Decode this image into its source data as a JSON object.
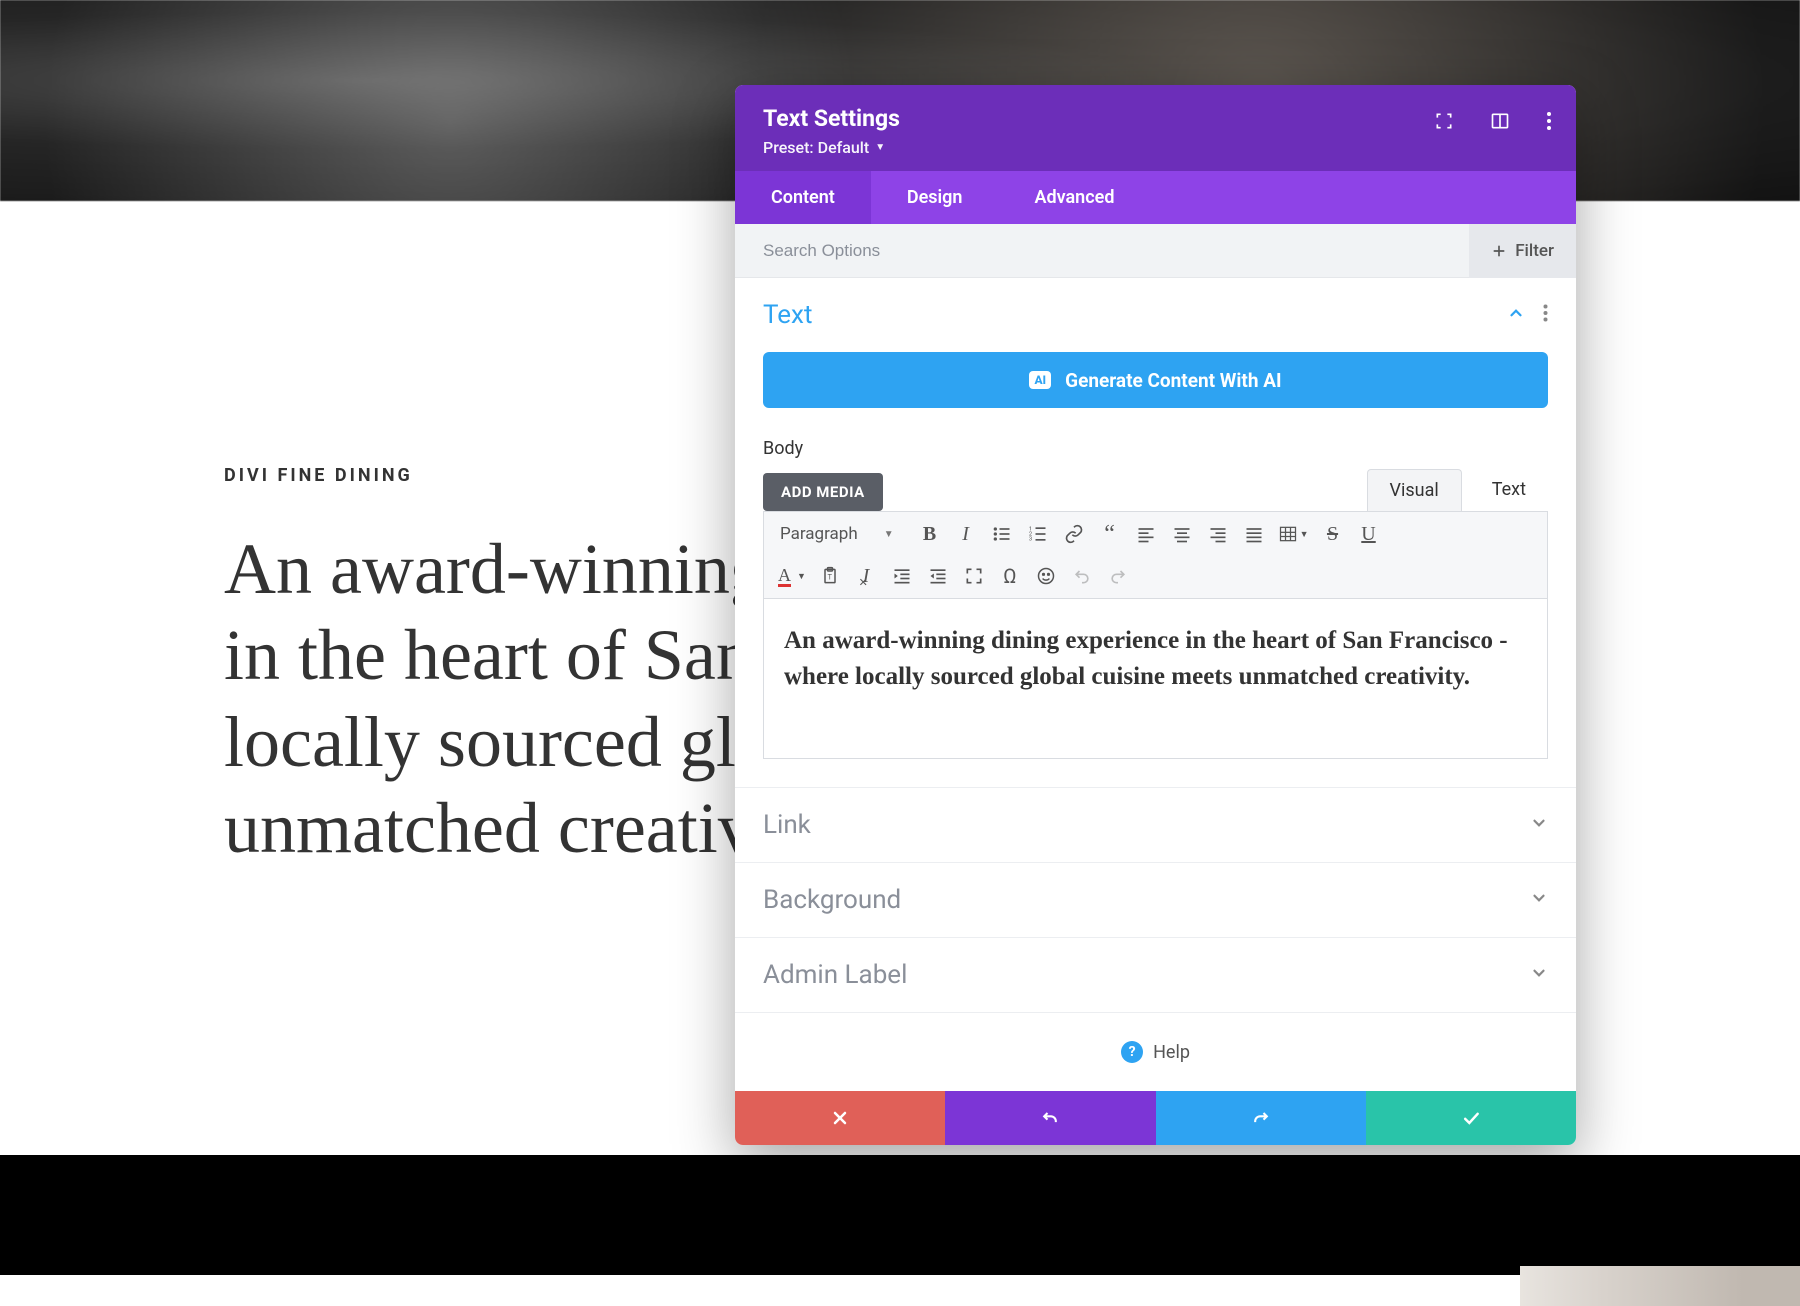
{
  "page": {
    "eyebrow": "DIVI FINE DINING",
    "headline": "An award-winning dining experience in the heart of San Francisco - where locally sourced global cuisine meets unmatched creativity."
  },
  "modal": {
    "title": "Text Settings",
    "preset_label": "Preset: Default",
    "tabs": {
      "content": "Content",
      "design": "Design",
      "advanced": "Advanced"
    },
    "active_tab": "content",
    "search_placeholder": "Search Options",
    "filter_label": "Filter",
    "text_section": {
      "title": "Text",
      "generate_ai_label": "Generate Content With AI",
      "ai_badge": "AI",
      "body_label": "Body",
      "add_media_label": "ADD MEDIA",
      "editor_tabs": {
        "visual": "Visual",
        "text": "Text"
      },
      "active_editor_tab": "visual",
      "format_select": "Paragraph",
      "body_content": "An award-winning dining experience in the heart of San Francisco - where locally sourced global cuisine meets unmatched creativity."
    },
    "sections": {
      "link": "Link",
      "background": "Background",
      "admin_label": "Admin Label"
    },
    "help_label": "Help"
  }
}
